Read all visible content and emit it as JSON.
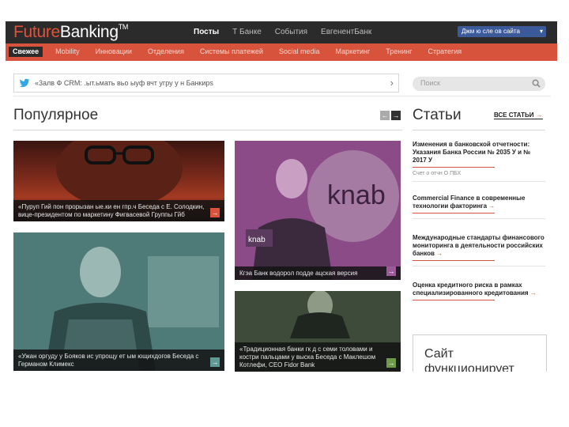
{
  "header": {
    "logo_part1": "Future",
    "logo_part2": "Banking",
    "logo_tm": "TM",
    "nav": [
      "Посты",
      "Т Банке",
      "События",
      "ЕвгенентБанк"
    ],
    "lang_select": "Джм  ю сле ов сайта"
  },
  "subnav": [
    "Свежее",
    "Mobility",
    "Инновации",
    "Отделения",
    "Системы платежей",
    "Social media",
    "Маркетинг",
    "Тренинг",
    "Стратегия"
  ],
  "tweet": {
    "text": "«3алв   Ф  CRM:  .ыт.ьмать  вьо ыуф  вчт  угру у н  Банкирs"
  },
  "search": {
    "placeholder": "Поиск"
  },
  "popular": {
    "title": "Популярное",
    "prev_arrow": "←",
    "next_arrow": "→",
    "cards": [
      {
        "caption": "«Пуруп   Гий  пон прорызан ые.ки  ен  гпр.ч Беседа с Е. Солодкин, вице-президентом по маркетину Фигвасевой Группы Гйб"
      },
      {
        "caption": "Кгэа     Банк водорол  подде  ацская версия"
      },
      {
        "caption": "«Ужан оргуду  у Бояков   ис  упрощу  ет  ым ющихдогов Беседа с Германом Климекс"
      },
      {
        "caption": "«Традиционная банки  гк д      с семи толовами и костри пальцами у  выска Беседа с Маклешом Котлефи, CEO Fidor Bank"
      }
    ]
  },
  "articles": {
    "title": "Статьи",
    "all_link": "ВСЕ СТАТЬИ",
    "arrow": "→",
    "items": [
      {
        "title": "Изменения в банковской отчетности: Указания Банка России № 2035 У и № 2017 У",
        "meta": "Счет  о  отчн  О ПБХ"
      },
      {
        "title": "Commercial Finance в современные технологии факторинга",
        "meta": ""
      },
      {
        "title": "Международные стандарты финансового мониторинга в деятельности российских банков",
        "meta": ""
      },
      {
        "title": "Оценка кредитного риска в рамках специализированного кредитования",
        "meta": ""
      }
    ]
  },
  "promo": {
    "text": "Сайт функционирует"
  },
  "colors": {
    "accent": "#d8533c",
    "dark": "#2b2b2b",
    "link_blue": "#3c5a9a"
  }
}
